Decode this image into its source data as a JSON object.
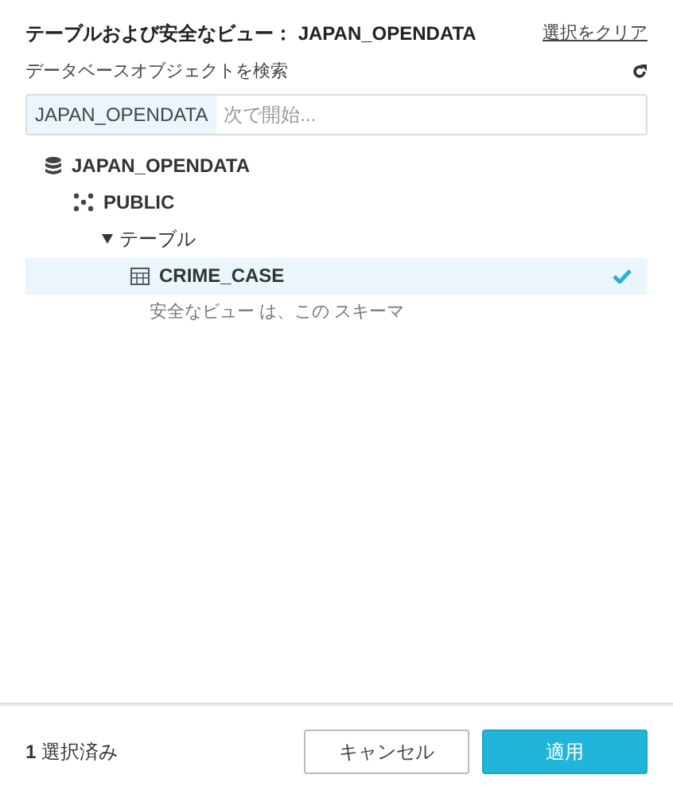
{
  "header": {
    "title": "テーブルおよび安全なビュー： JAPAN_OPENDATA",
    "clear_link": "選択をクリア"
  },
  "search": {
    "label": "データベースオブジェクトを検索",
    "prefix": "JAPAN_OPENDATA",
    "placeholder": "次で開始..."
  },
  "tree": [
    {
      "kind": "database",
      "label": "JAPAN_OPENDATA",
      "children": [
        {
          "kind": "schema",
          "label": "PUBLIC",
          "children": [
            {
              "kind": "folder",
              "label": "テーブル",
              "expanded": true,
              "children": [
                {
                  "kind": "table",
                  "label": "CRIME_CASE",
                  "selected": true
                },
                {
                  "kind": "note",
                  "label": "安全なビュー は、この スキーマ"
                }
              ]
            }
          ]
        }
      ]
    }
  ],
  "footer": {
    "count": "**1** 選択済み",
    "buttons": [
      {
        "label": "キャンセル",
        "kind": "secondary"
      },
      {
        "label": "適用",
        "kind": "primary"
      }
    ]
  }
}
